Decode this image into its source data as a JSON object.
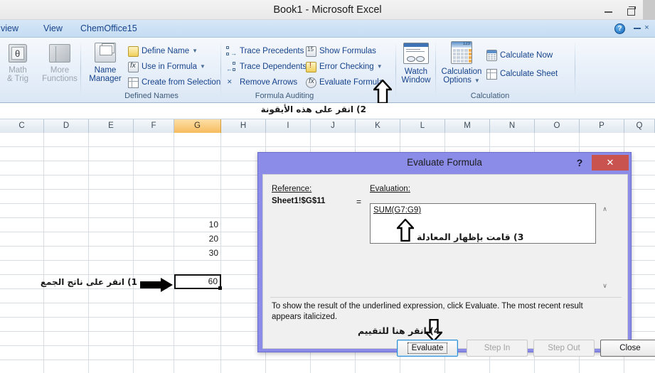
{
  "window": {
    "title": "Book1  -  Microsoft Excel",
    "minimize_label": "minimize",
    "restore_label": "restore"
  },
  "ribbon": {
    "tabs": [
      {
        "label": "view"
      },
      {
        "label": "View"
      },
      {
        "label": "ChemOffice15"
      }
    ],
    "help_label": "?",
    "minimize_ribbon_label": "–",
    "close_label": "×",
    "groups": [
      {
        "title": "",
        "buttons": [
          {
            "label_line1": "Math",
            "label_line2": "& Trig",
            "icon": "math-trig-icon",
            "disabled": true
          },
          {
            "label_line1": "More",
            "label_line2": "Functions",
            "icon": "more-functions-icon",
            "disabled": true
          }
        ]
      },
      {
        "title": "Defined Names",
        "big": {
          "label_line1": "Name",
          "label_line2": "Manager",
          "icon": "name-manager-icon"
        },
        "items": [
          {
            "label": "Define Name",
            "icon": "define-name-icon",
            "caret": true
          },
          {
            "label": "Use in Formula",
            "icon": "use-in-formula-icon",
            "caret": true
          },
          {
            "label": "Create from Selection",
            "icon": "create-from-selection-icon",
            "caret": false
          }
        ]
      },
      {
        "title": "Formula Auditing",
        "items_left": [
          {
            "label": "Trace Precedents",
            "icon": "trace-precedents-icon",
            "caret": false
          },
          {
            "label": "Trace Dependents",
            "icon": "trace-dependents-icon",
            "caret": false
          },
          {
            "label": "Remove Arrows",
            "icon": "remove-arrows-icon",
            "caret": true
          }
        ],
        "items_right": [
          {
            "label": "Show Formulas",
            "icon": "show-formulas-icon",
            "caret": false
          },
          {
            "label": "Error Checking",
            "icon": "error-checking-icon",
            "caret": true
          },
          {
            "label": "Evaluate Formula",
            "icon": "evaluate-formula-icon",
            "caret": false
          }
        ],
        "watch": {
          "label_line1": "Watch",
          "label_line2": "Window",
          "icon": "watch-window-icon"
        }
      },
      {
        "title": "Calculation",
        "big": {
          "label_line1": "Calculation",
          "label_line2": "Options",
          "icon": "calculation-options-icon",
          "caret": true
        },
        "items": [
          {
            "label": "Calculate Now",
            "icon": "calculate-now-icon"
          },
          {
            "label": "Calculate Sheet",
            "icon": "calculate-sheet-icon"
          }
        ]
      }
    ]
  },
  "annotations": {
    "step2": "2) انقر على هذه الأيقونة",
    "step1": "1) انقر على ناتج الجمع",
    "step3": "3) قامت بإظهار المعادلة",
    "step4": "4) انقر هنا للتقييم"
  },
  "sheet": {
    "column_headers": [
      "C",
      "D",
      "E",
      "F",
      "G",
      "H",
      "I",
      "J",
      "K",
      "L",
      "M",
      "N",
      "O",
      "P",
      "Q"
    ],
    "selected_column": "G",
    "cells": [
      {
        "column": "G",
        "row": 7,
        "value": "10"
      },
      {
        "column": "G",
        "row": 8,
        "value": "20"
      },
      {
        "column": "G",
        "row": 9,
        "value": "30"
      }
    ],
    "selected_cell": {
      "column": "G",
      "row": 11,
      "value": "60"
    }
  },
  "dialog": {
    "title": "Evaluate Formula",
    "help_label": "?",
    "close_label": "✕",
    "reference_label": "Reference:",
    "reference_value": "Sheet1!$G$11",
    "equals": "=",
    "evaluation_label": "Evaluation:",
    "evaluation_formula": "SUM(G7:G9)",
    "scroll_up_label": "∧",
    "scroll_down_label": "∨",
    "help_text": "To show the result of the underlined expression, click Evaluate.  The most recent result appears italicized.",
    "buttons": [
      {
        "label": "Evaluate",
        "state": "focused"
      },
      {
        "label": "Step In",
        "state": "disabled"
      },
      {
        "label": "Step Out",
        "state": "disabled"
      },
      {
        "label": "Close",
        "state": "default"
      }
    ]
  },
  "colors": {
    "dialog_frame": "#8a8ce8",
    "close_red": "#c9534f",
    "selected_header": "#f6bc5f",
    "ribbon_text": "#15428b"
  }
}
